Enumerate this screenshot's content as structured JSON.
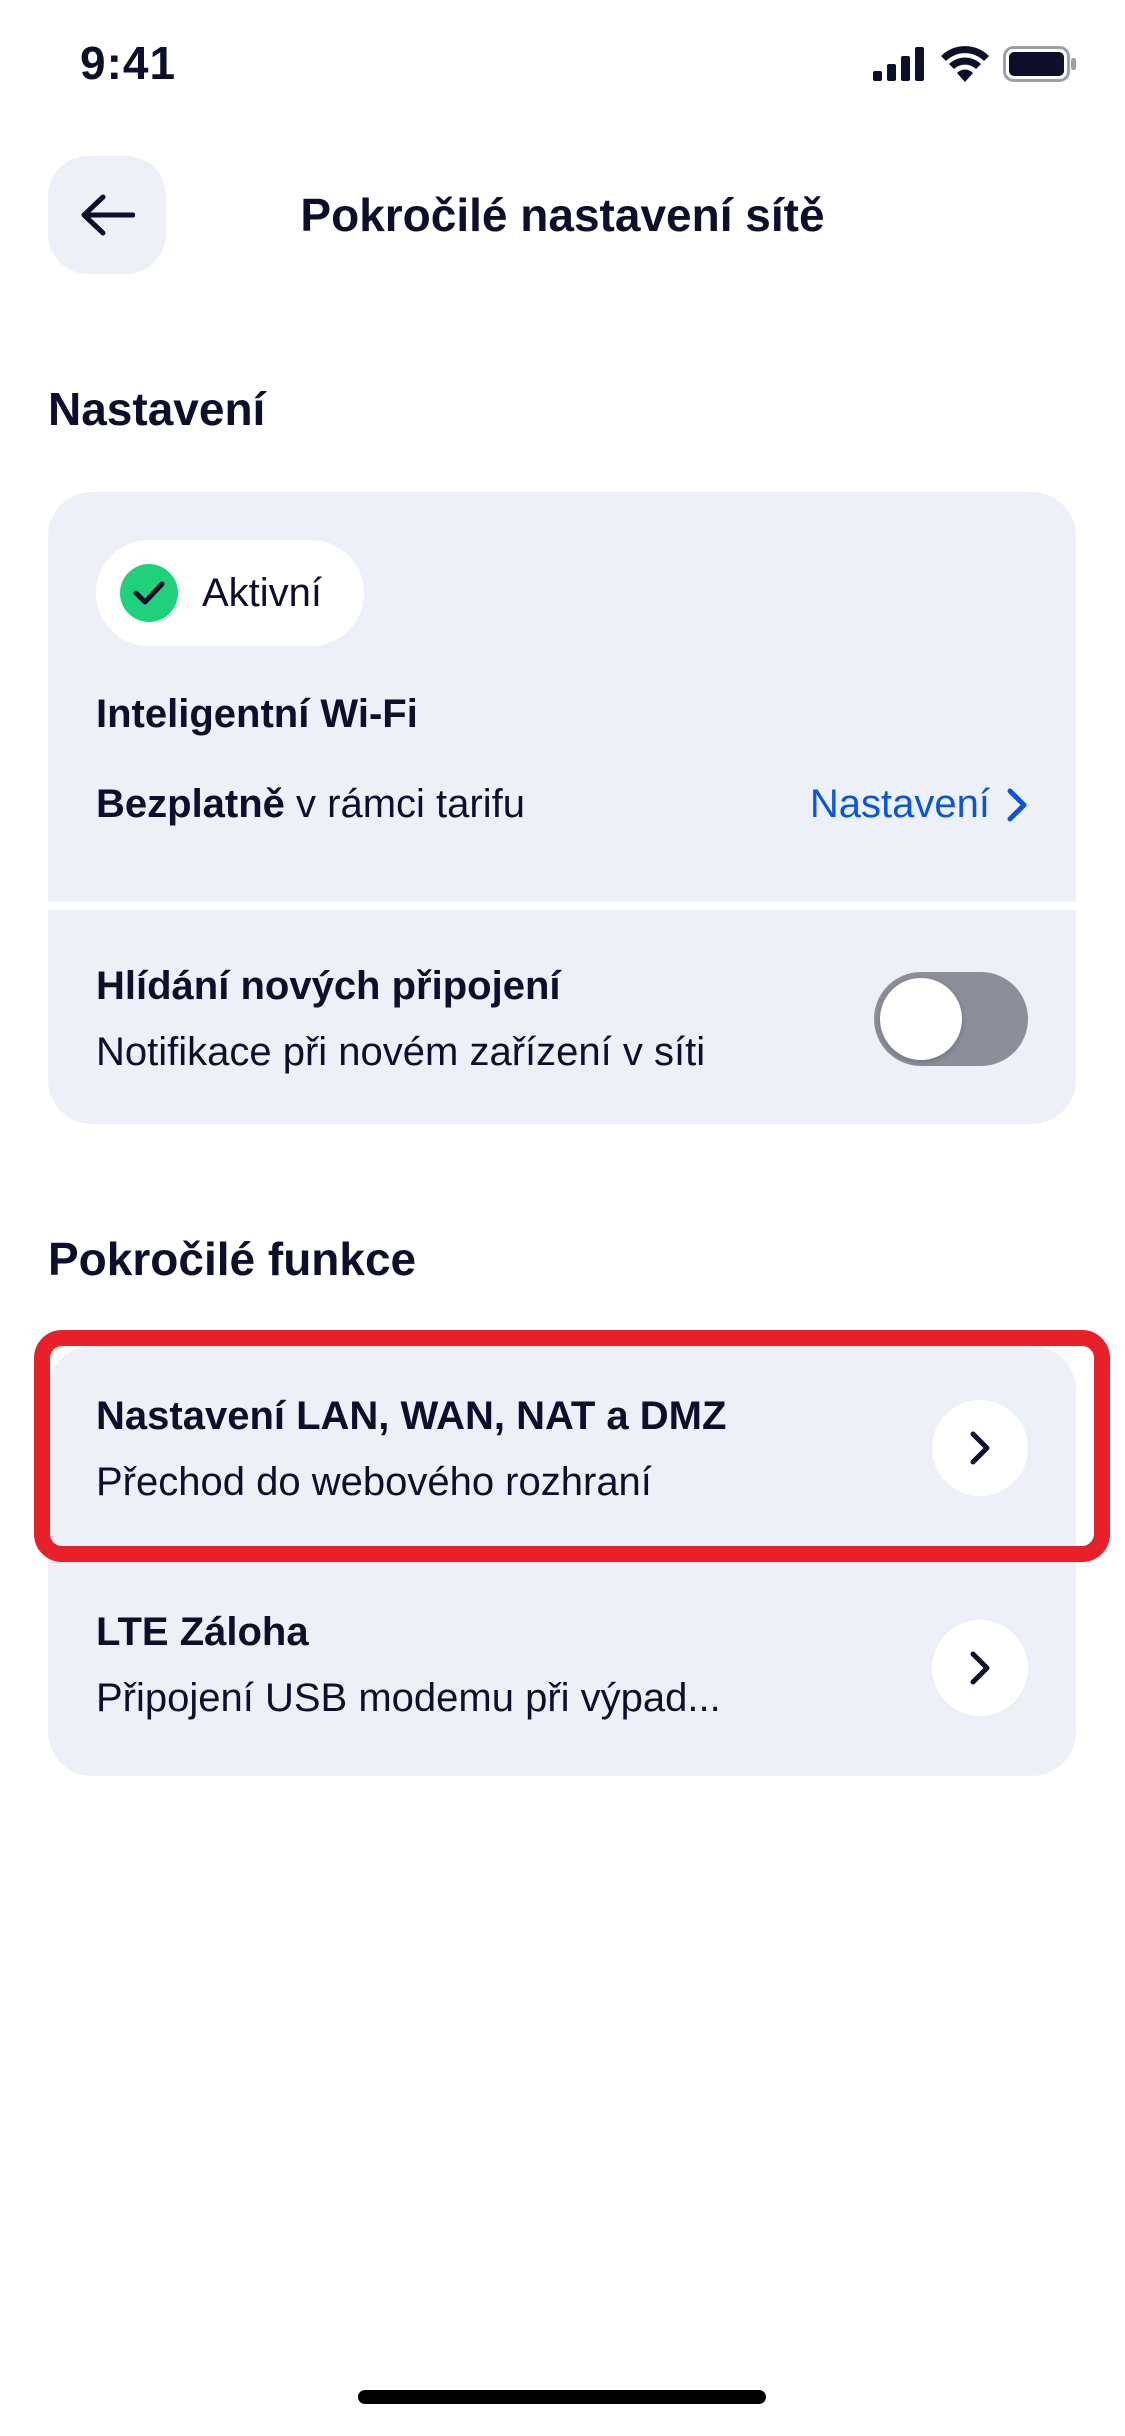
{
  "status_bar": {
    "time": "9:41"
  },
  "header": {
    "title": "Pokročilé nastavení sítě"
  },
  "settings_section": {
    "heading": "Nastavení",
    "status_badge": "Aktivní",
    "wifi_title": "Inteligentní Wi-Fi",
    "price_bold": "Bezplatně",
    "price_rest": " v rámci tarifu",
    "settings_link": "Nastavení",
    "monitor_title": "Hlídání nových připojení",
    "monitor_subtitle": "Notifikace při novém zařízení v síti",
    "monitor_toggle_on": false
  },
  "advanced_section": {
    "heading": "Pokročilé funkce",
    "items": [
      {
        "title": "Nastavení LAN, WAN, NAT a DMZ",
        "subtitle": "Přechod do webového rozhraní"
      },
      {
        "title": "LTE Záloha",
        "subtitle": "Připojení USB modemu při výpad..."
      }
    ]
  },
  "colors": {
    "accent": "#0b55d9",
    "success": "#1fd17a",
    "card_bg": "#eef0f8",
    "highlight": "#e8202a",
    "toggle_off": "#8c8f9a"
  },
  "icons": [
    "signal-icon",
    "wifi-icon",
    "battery-icon",
    "back-arrow-icon",
    "checkmark-icon",
    "chevron-right-icon"
  ]
}
